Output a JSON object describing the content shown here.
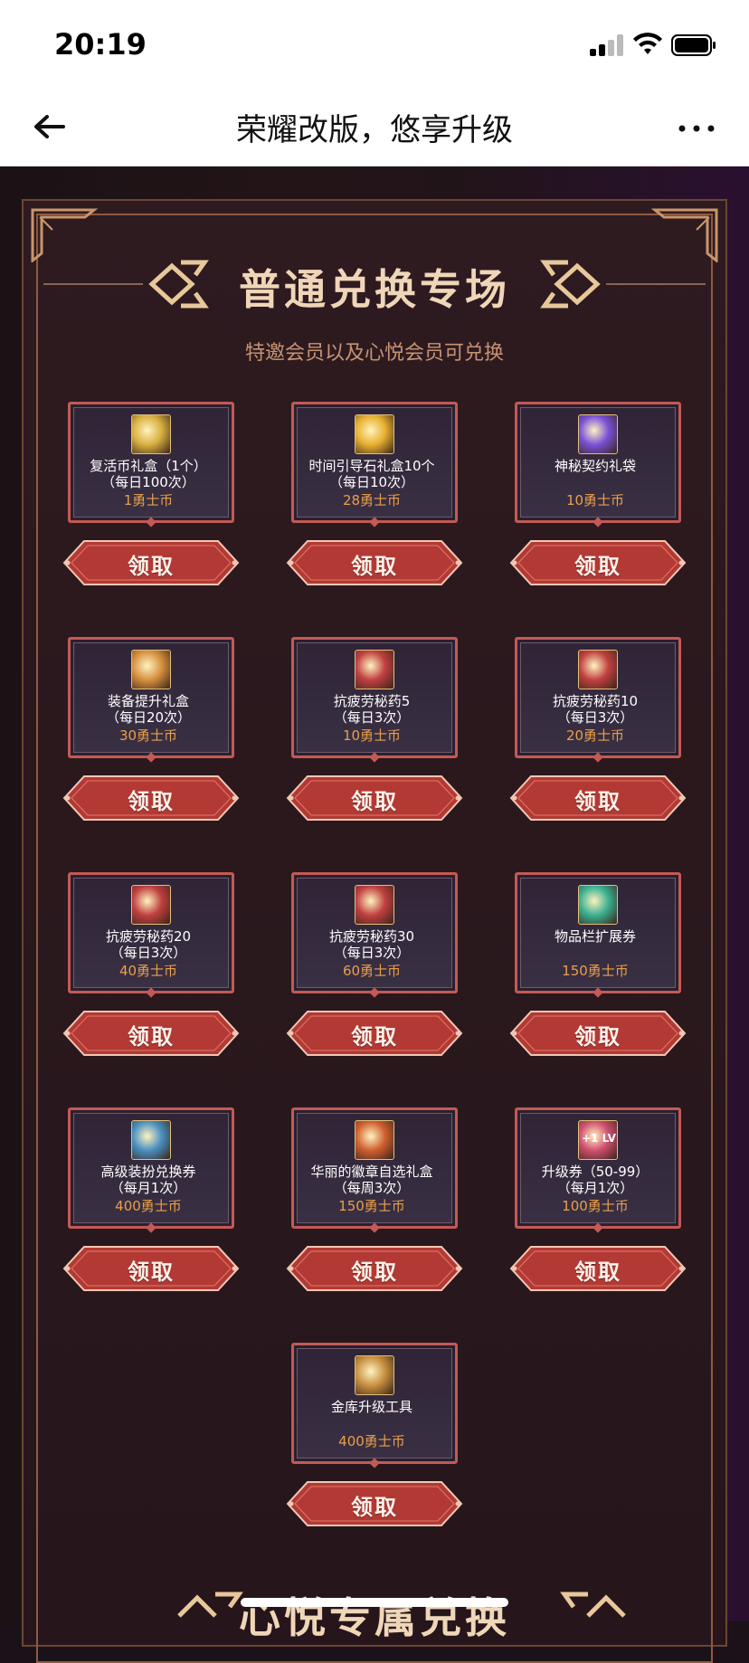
{
  "status_bar": {
    "time": "20:19"
  },
  "nav": {
    "title": "荣耀改版，悠享升级",
    "back_icon": "back-arrow-icon",
    "more_icon": "more-icon"
  },
  "section": {
    "title": "普通兑换专场",
    "subtitle": "特邀会员以及心悦会员可兑换"
  },
  "claim_label": "领取",
  "items": [
    {
      "name": "复活币礼盒（1个）",
      "limit": "（每日100次）",
      "cost": "1勇士币",
      "icon": "coin-box-icon",
      "color": "#d8b040"
    },
    {
      "name": "时间引导石礼盒10个",
      "limit": "（每日10次）",
      "cost": "28勇士币",
      "icon": "guide-stone-box-icon",
      "color": "#e8b030"
    },
    {
      "name": "神秘契约礼袋",
      "limit": "",
      "cost": "10勇士币",
      "icon": "mystery-bag-icon",
      "color": "#7a50d8"
    },
    {
      "name": "装备提升礼盒",
      "limit": "（每日20次）",
      "cost": "30勇士币",
      "icon": "upgrade-box-icon",
      "color": "#d89040"
    },
    {
      "name": "抗疲劳秘药5",
      "limit": "（每日3次）",
      "cost": "10勇士币",
      "icon": "potion-icon",
      "color": "#c04040"
    },
    {
      "name": "抗疲劳秘药10",
      "limit": "（每日3次）",
      "cost": "20勇士币",
      "icon": "potion-icon",
      "color": "#c04040"
    },
    {
      "name": "抗疲劳秘药20",
      "limit": "（每日3次）",
      "cost": "40勇士币",
      "icon": "potion-icon",
      "color": "#c04040"
    },
    {
      "name": "抗疲劳秘药30",
      "limit": "（每日3次）",
      "cost": "60勇士币",
      "icon": "potion-icon",
      "color": "#c04040"
    },
    {
      "name": "物品栏扩展券",
      "limit": "",
      "cost": "150勇士币",
      "icon": "inventory-ticket-icon",
      "color": "#3ab090"
    },
    {
      "name": "高级装扮兑换券",
      "limit": "（每月1次）",
      "cost": "400勇士币",
      "icon": "avatar-ticket-icon",
      "color": "#4a90c0"
    },
    {
      "name": "华丽的徽章自选礼盒",
      "limit": "（每周3次）",
      "cost": "150勇士币",
      "icon": "emblem-box-icon",
      "color": "#d06030"
    },
    {
      "name": "升级券（50-99）",
      "limit": "（每月1次）",
      "cost": "100勇士币",
      "icon": "level-up-ticket-icon",
      "color": "#d05070",
      "badge": "+1 LV"
    },
    {
      "name": "金库升级工具",
      "limit": "",
      "cost": "400勇士币",
      "icon": "vault-upgrade-icon",
      "color": "#c89040"
    }
  ],
  "next_section": {
    "title": "心悦专属兑换"
  },
  "colors": {
    "accent_gold": "#f0d6b8",
    "card_border": "#c25a55",
    "cost_orange": "#e9a04a",
    "button_red": "#b83a36"
  }
}
